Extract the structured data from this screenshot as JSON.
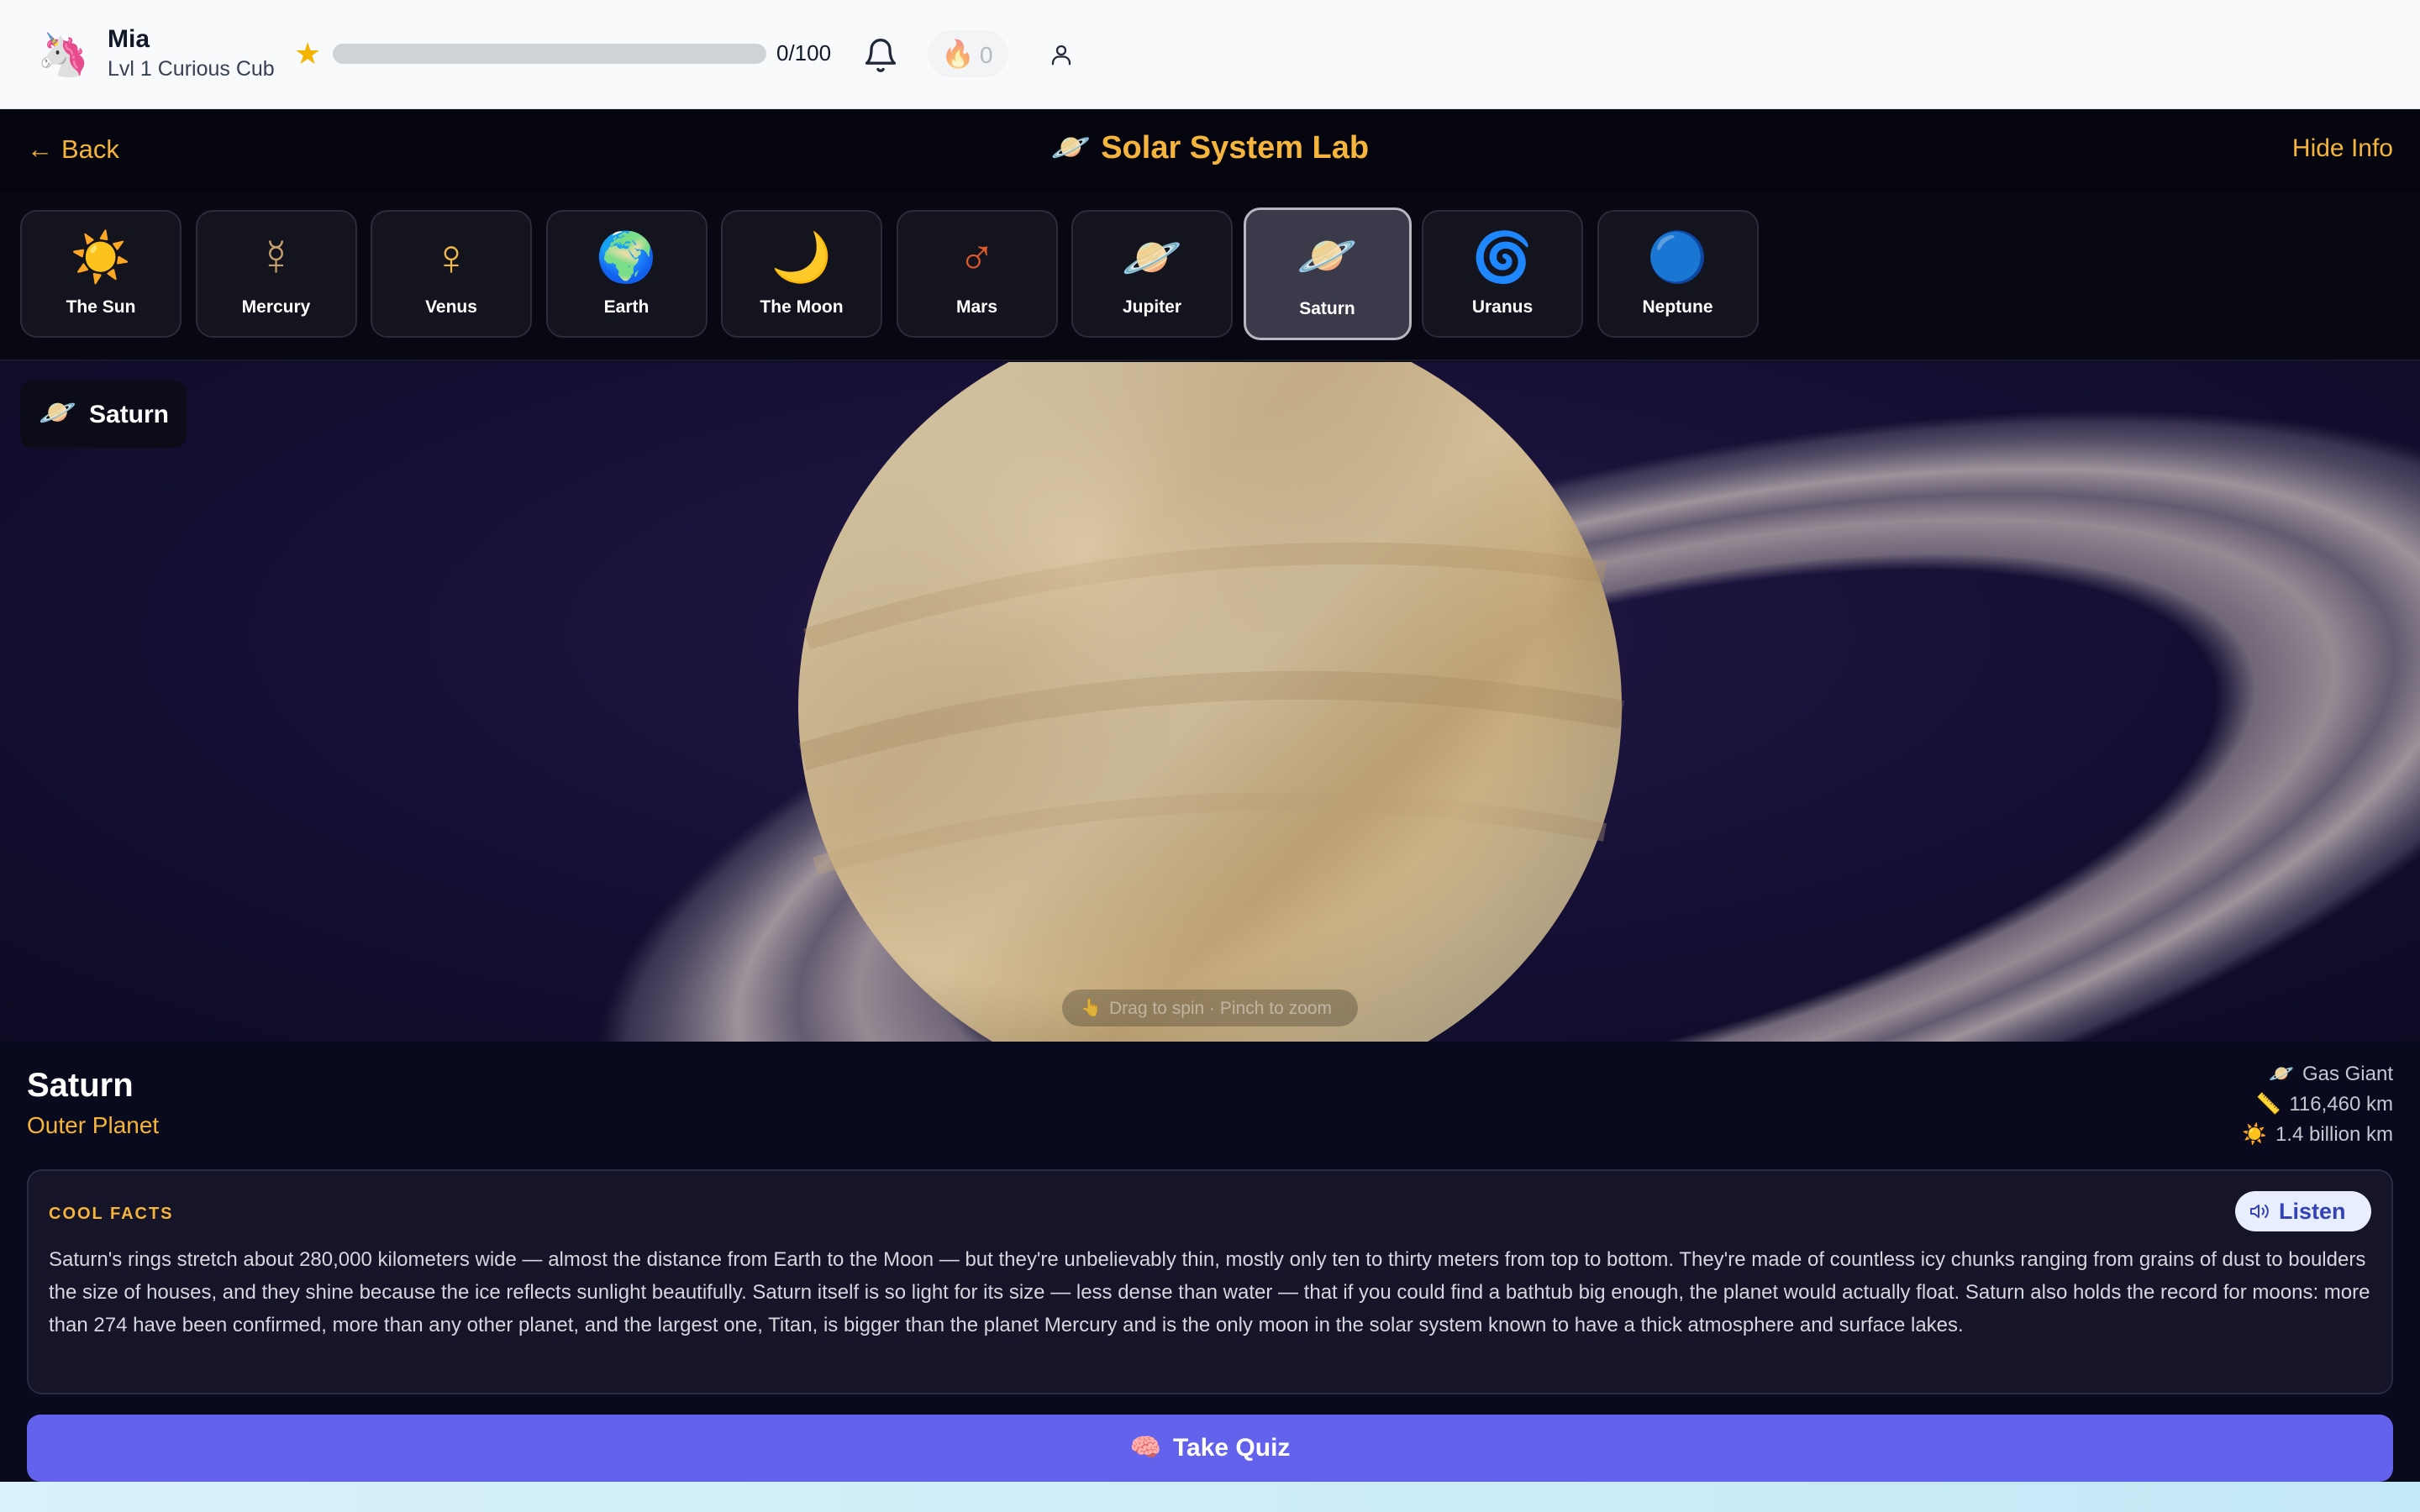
{
  "user": {
    "name": "Mia",
    "level": "Lvl 1 Curious Cub",
    "avatar": "unicorn-icon",
    "xp_text": "0/100",
    "xp_progress": 0,
    "streak": "0"
  },
  "header": {
    "back_label": "Back",
    "title": "Solar System Lab",
    "title_icon": "🪐",
    "hide_info_label": "Hide Info"
  },
  "planets": [
    {
      "label": "The Sun",
      "icon": "☀️"
    },
    {
      "label": "Mercury",
      "icon": "☿"
    },
    {
      "label": "Venus",
      "icon": "♀"
    },
    {
      "label": "Earth",
      "icon": "🌍"
    },
    {
      "label": "The Moon",
      "icon": "🌙"
    },
    {
      "label": "Mars",
      "icon": "♂"
    },
    {
      "label": "Jupiter",
      "icon": "🪐"
    },
    {
      "label": "Saturn",
      "icon": "🪐"
    },
    {
      "label": "Uranus",
      "icon": "🌀"
    },
    {
      "label": "Neptune",
      "icon": "🔵"
    }
  ],
  "selected_planet": "Saturn",
  "viewer": {
    "badge_label": "Saturn",
    "badge_icon": "🪐",
    "hint_icon": "👆",
    "hint": "Drag to spin · Pinch to zoom"
  },
  "info": {
    "name": "Saturn",
    "category": "Outer Planet",
    "stats": [
      {
        "icon": "🪐",
        "text": "Gas Giant"
      },
      {
        "icon": "📏",
        "text": "116,460 km"
      },
      {
        "icon": "☀️",
        "text": "1.4 billion km"
      }
    ],
    "facts_heading": "COOL FACTS",
    "listen_label": "Listen",
    "facts": "Saturn's rings stretch about 280,000 kilometers wide — almost the distance from Earth to the Moon — but they're unbelievably thin, mostly only ten to thirty meters from top to bottom. They're made of countless icy chunks ranging from grains of dust to boulders the size of houses, and they shine because the ice reflects sunlight beautifully. Saturn itself is so light for its size — less dense than water — that if you could find a bathtub big enough, the planet would actually float. Saturn also holds the record for moons: more than 274 have been confirmed, more than any other planet, and the largest one, Titan, is bigger than the planet Mercury and is the only moon in the solar system known to have a thick atmosphere and surface lakes.",
    "quiz_label": "Take Quiz",
    "quiz_icon": "🧠"
  },
  "colors": {
    "accent": "#f5b43c",
    "quiz_button": "#6262ec",
    "background": "#0a0a1e"
  }
}
